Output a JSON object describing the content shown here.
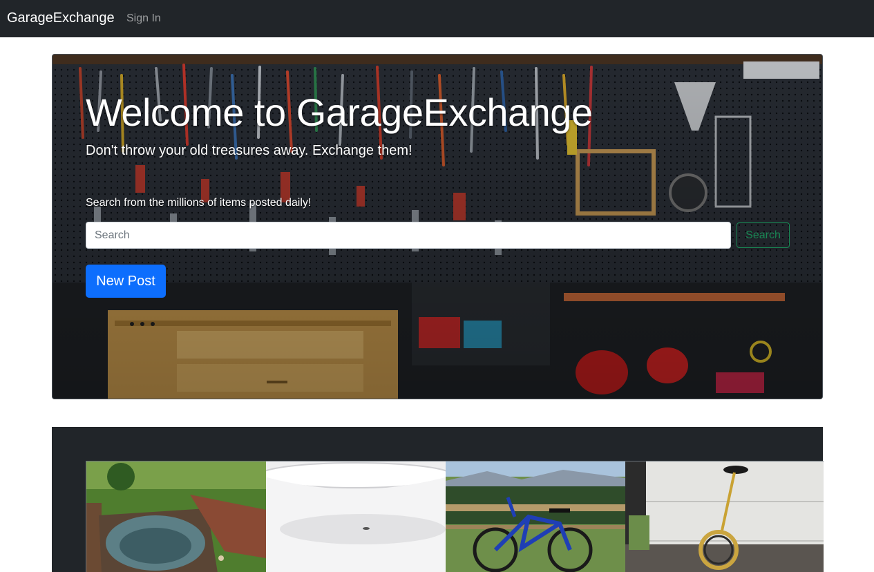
{
  "navbar": {
    "brand": "GarageExchange",
    "sign_in": "Sign In",
    "background": "#212529"
  },
  "hero": {
    "title": "Welcome to GarageExchange",
    "lead": "Don't throw your old treasures away. Exchange them!",
    "search_help": "Search from the millions of items posted daily!",
    "search_placeholder": "Search",
    "search_button": "Search",
    "new_post_button": "New Post",
    "background_image": "garage-workshop-tools-photo"
  },
  "listings": {
    "items": [
      {
        "image": "hot-tub-photo"
      },
      {
        "image": "bathtub-photo"
      },
      {
        "image": "bicycle-photo"
      },
      {
        "image": "unicycle-photo"
      }
    ]
  },
  "colors": {
    "primary": "#0d6efd",
    "success": "#198754",
    "dark": "#212529"
  }
}
